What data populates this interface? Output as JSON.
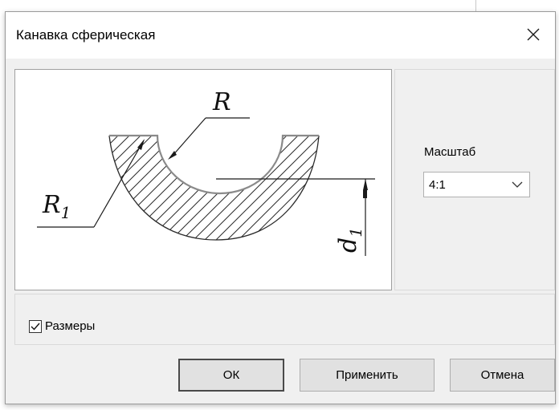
{
  "dialog": {
    "title": "Канавка сферическая"
  },
  "preview": {
    "label_r": "R",
    "label_r1": "R",
    "label_r1_sub": "1",
    "label_d1": "d",
    "label_d1_sub": "1"
  },
  "scale": {
    "label": "Масштаб",
    "value": "4:1"
  },
  "options": {
    "dimensions_label": "Размеры",
    "dimensions_checked": true
  },
  "buttons": {
    "ok": "ОК",
    "apply": "Применить",
    "cancel": "Отмена"
  },
  "icons": {
    "close": "close-icon",
    "chevron": "chevron-down-icon",
    "check": "checkmark-icon"
  }
}
